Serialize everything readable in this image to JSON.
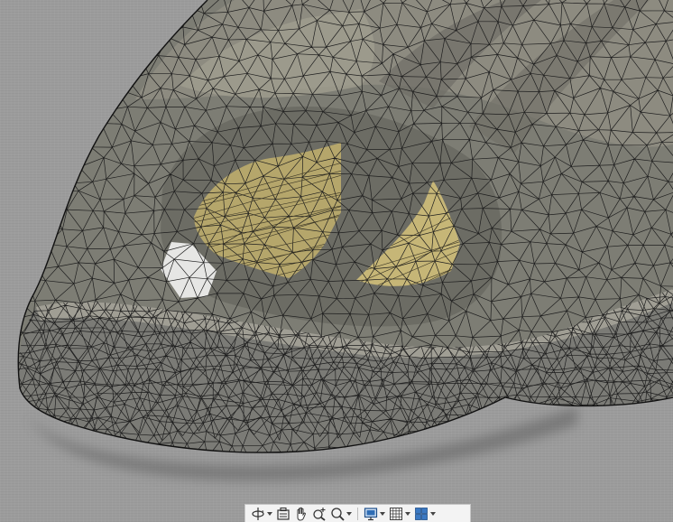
{
  "viewport": {
    "background_color": "#9c9c9c",
    "model": {
      "shell_color": "#7d7d74",
      "shell_highlight": "#a8a79b",
      "interior_color": "#bfb06f",
      "edge_color": "#1e1e1e",
      "highlight_white": "#e8e8e8"
    }
  },
  "toolbar": {
    "tools": [
      {
        "name": "orbit-tool",
        "icon": "orbit-icon",
        "has_dropdown": true
      },
      {
        "name": "look-at-tool",
        "icon": "look-at-icon",
        "has_dropdown": false
      },
      {
        "name": "pan-tool",
        "icon": "hand-icon",
        "has_dropdown": false
      },
      {
        "name": "zoom-tool",
        "icon": "zoom-plus-icon",
        "has_dropdown": false
      },
      {
        "name": "fit-tool",
        "icon": "zoom-window-icon",
        "has_dropdown": true
      },
      {
        "name": "display-settings-tool",
        "icon": "monitor-icon",
        "has_dropdown": true
      },
      {
        "name": "grid-settings-tool",
        "icon": "grid-icon",
        "has_dropdown": true
      },
      {
        "name": "viewports-tool",
        "icon": "viewports-icon",
        "has_dropdown": true
      }
    ]
  }
}
